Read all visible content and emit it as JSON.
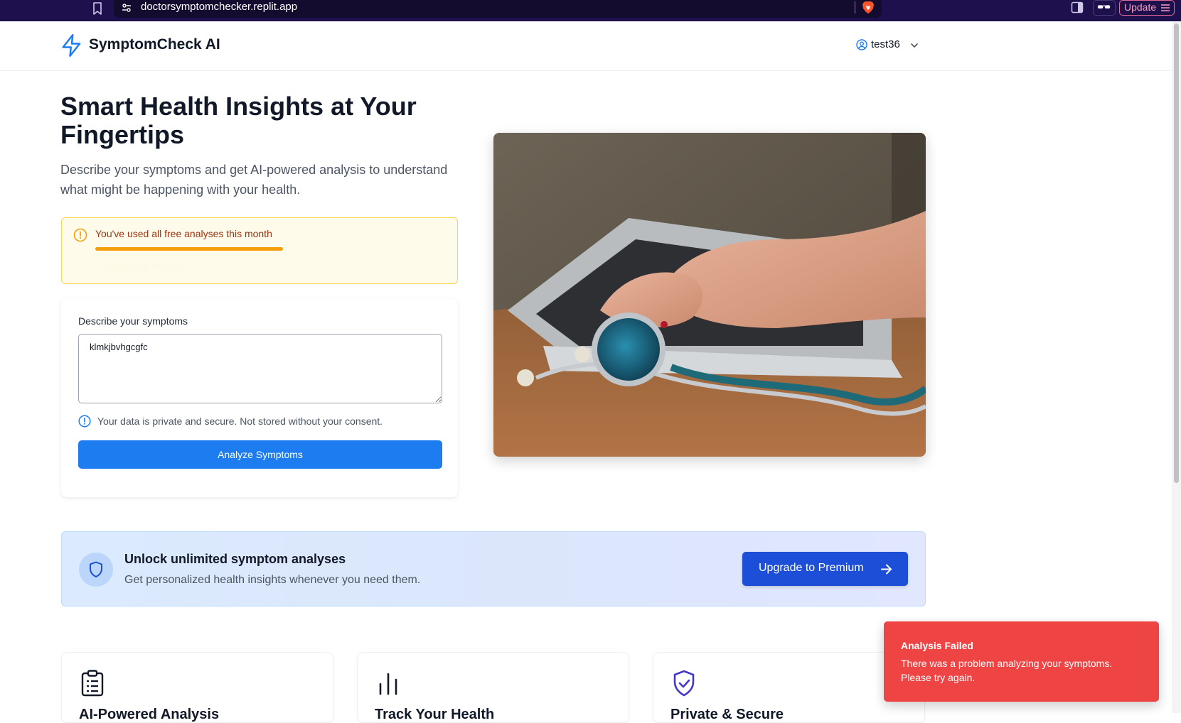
{
  "browser": {
    "url": "doctorsymptomchecker.replit.app",
    "update_label": "Update"
  },
  "header": {
    "app_name": "SymptomCheck AI",
    "username": "test36"
  },
  "hero": {
    "title": "Smart Health Insights at Your Fingertips",
    "subtitle": "Describe your symptoms and get AI-powered analysis to understand what might be happening with your health."
  },
  "usage_warning": {
    "text": "You've used all free analyses this month",
    "usage_fraction": 1.0,
    "link_label": "Upgrade to Premium"
  },
  "symptom_form": {
    "label": "Describe your symptoms",
    "value": "klmkjbvhgcgfc",
    "privacy_note": "Your data is private and secure. Not stored without your consent.",
    "submit_label": "Analyze Symptoms"
  },
  "premium_banner": {
    "title": "Unlock unlimited symptom analyses",
    "subtitle": "Get personalized health insights whenever you need them.",
    "button_label": "Upgrade to Premium"
  },
  "features": [
    {
      "title": "AI-Powered Analysis",
      "icon": "clipboard-list-icon"
    },
    {
      "title": "Track Your Health",
      "icon": "bar-chart-icon"
    },
    {
      "title": "Private & Secure",
      "icon": "shield-check-icon"
    }
  ],
  "toast": {
    "title": "Analysis Failed",
    "message": "There was a problem analyzing your symptoms. Please try again."
  },
  "colors": {
    "primary": "#1d7cf0",
    "premium_button": "#1d4ed8",
    "warning_bg": "#fffbeb",
    "warning_text": "#9a3412",
    "toast_bg": "#ef4444"
  }
}
